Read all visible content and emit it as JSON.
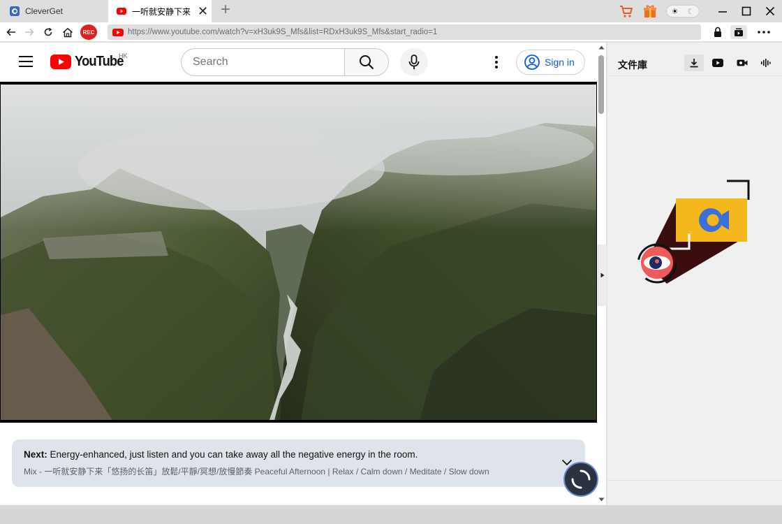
{
  "tabs": [
    {
      "title": "CleverGet",
      "active": false
    },
    {
      "title": "一听就安静下来「悠",
      "active": true
    }
  ],
  "address_bar": {
    "url": "https://www.youtube.com/watch?v=xH3uk9S_Mfs&list=RDxH3uk9S_Mfs&start_radio=1",
    "rec_label": "REC"
  },
  "youtube": {
    "logo_text": "YouTube",
    "region": "HK",
    "search_placeholder": "Search",
    "sign_in_label": "Sign in",
    "next": {
      "label": "Next:",
      "title": "Energy-enhanced, just listen and you can take away all the negative energy in the room.",
      "subtitle": "Mix - 一听就安静下来「悠扬的长笛」放鬆/平靜/冥想/放慢節奏 Peaceful Afternoon | Relax / Calm down / Meditate / Slow down"
    }
  },
  "library": {
    "title": "文件庫"
  },
  "colors": {
    "youtube_red": "#ff0000",
    "rec_red": "#e0201e",
    "link_blue": "#065fd4",
    "logo_yellow": "#f5b81c"
  }
}
